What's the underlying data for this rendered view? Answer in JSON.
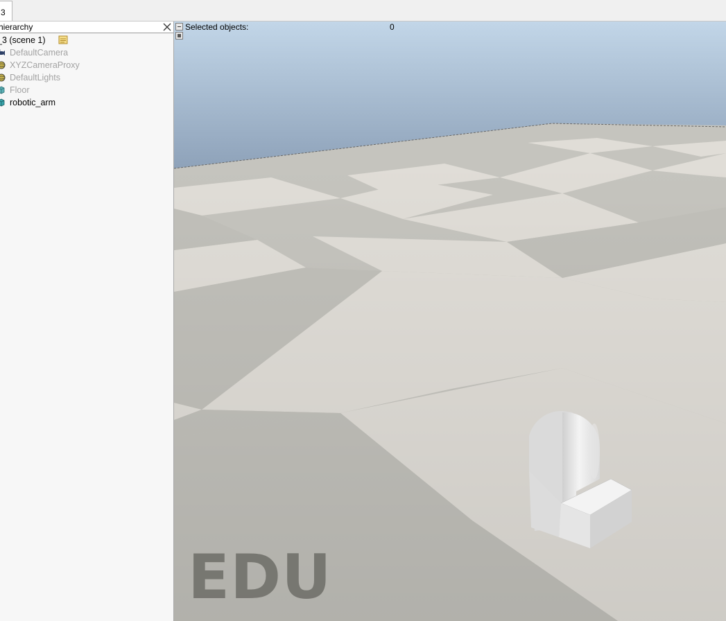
{
  "tab": {
    "label": "3"
  },
  "hierarchy": {
    "title": "hierarchy",
    "items": [
      {
        "label": "_3 (scene 1)",
        "icon": "scene-root-icon",
        "dim": false
      },
      {
        "label": "DefaultCamera",
        "icon": "camera-icon",
        "dim": true
      },
      {
        "label": "XYZCameraProxy",
        "icon": "sphere-icon",
        "dim": true
      },
      {
        "label": "DefaultLights",
        "icon": "sphere-icon",
        "dim": true
      },
      {
        "label": "Floor",
        "icon": "cube-icon",
        "dim": true
      },
      {
        "label": "robotic_arm",
        "icon": "cube-icon",
        "dim": false
      }
    ]
  },
  "viewport": {
    "selected_label": "Selected objects:",
    "selected_count": "0",
    "watermark": "EDU"
  },
  "colors": {
    "sky_top": "#bcd3e6",
    "sky_bottom": "#8b9fb6",
    "floor_light": "#dfdcd6",
    "floor_dark": "#c3c2bc",
    "panel_bg": "#f7f7f7"
  }
}
